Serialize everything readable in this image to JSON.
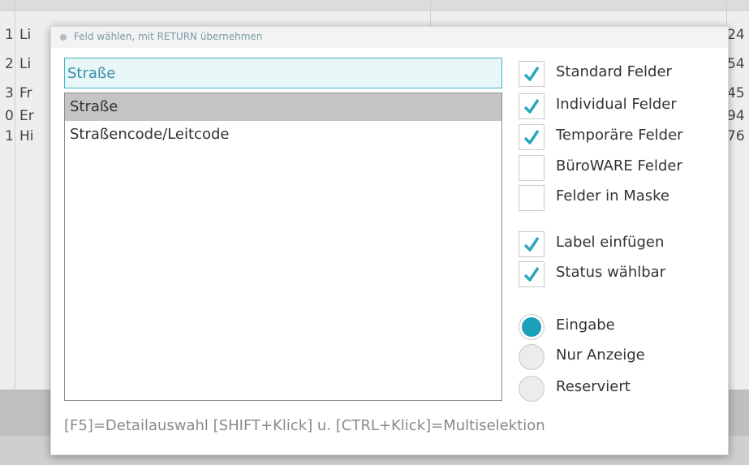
{
  "background": {
    "rows": [
      {
        "num": "1",
        "text": "Li",
        "right": "24"
      },
      {
        "num": "2",
        "text": "Li",
        "right": "54"
      },
      {
        "num": "3",
        "text": "Fr",
        "right": "45"
      },
      {
        "num": "0",
        "text": "Er",
        "right": "94"
      },
      {
        "num": "1",
        "text": "Hi",
        "right": "76"
      }
    ]
  },
  "dialog": {
    "title": "Feld wählen, mit RETURN übernehmen",
    "search": {
      "value": "Straße"
    },
    "list": [
      {
        "label": "Straße",
        "selected": true
      },
      {
        "label": "Straßencode/Leitcode",
        "selected": false
      }
    ],
    "checkboxes": [
      {
        "label": "Standard Felder",
        "checked": true
      },
      {
        "label": "Individual Felder",
        "checked": true
      },
      {
        "label": "Temporäre Felder",
        "checked": true
      },
      {
        "label": "BüroWARE Felder",
        "checked": false
      },
      {
        "label": "Felder in Maske",
        "checked": false
      },
      {
        "label": "Label einfügen",
        "checked": true
      },
      {
        "label": "Status wählbar",
        "checked": true
      }
    ],
    "radios": [
      {
        "label": "Eingabe",
        "selected": true
      },
      {
        "label": "Nur Anzeige",
        "selected": false
      },
      {
        "label": "Reserviert",
        "selected": false
      }
    ],
    "hint": "[F5]=Detailauswahl [SHIFT+Klick] u. [CTRL+Klick]=Multiselektion"
  },
  "colors": {
    "accent": "#1aa0b8",
    "check": "#2aa7bd"
  }
}
